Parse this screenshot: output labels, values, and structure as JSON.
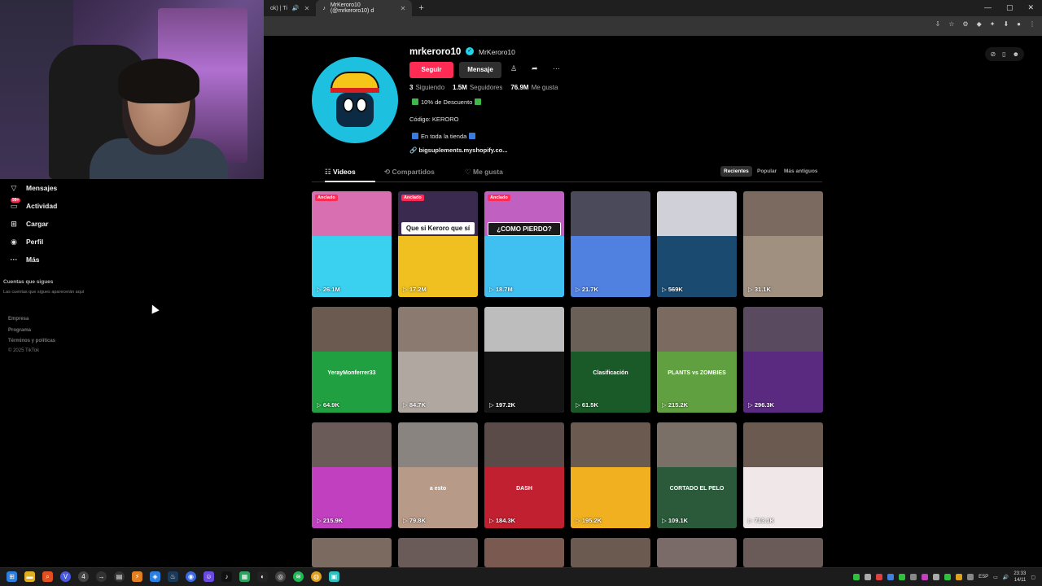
{
  "browser": {
    "tabs": [
      {
        "title": "ok) | Ti",
        "active": false
      },
      {
        "title": "MrKeroro10 (@mrkeroro10) d",
        "active": true
      }
    ],
    "new_tab": "+"
  },
  "nav": {
    "items": [
      {
        "label": "Mensajes",
        "icon": "send-icon"
      },
      {
        "label": "Actividad",
        "icon": "inbox-icon",
        "badge": "99+"
      },
      {
        "label": "Cargar",
        "icon": "upload-icon"
      },
      {
        "label": "Perfil",
        "icon": "avatar-icon"
      },
      {
        "label": "Más",
        "icon": "more-icon"
      }
    ],
    "following_title": "Cuentas que sigues",
    "following_text": "Las cuentas que sigues aparecerán aquí",
    "footer": [
      "Empresa",
      "Programa",
      "Términos y políticas",
      "© 2025 TikTok"
    ]
  },
  "profile": {
    "username": "mrkeroro10",
    "nickname": "MrKeroro10",
    "follow_label": "Seguir",
    "message_label": "Mensaje",
    "stats": [
      {
        "value": "3",
        "label": "Siguiendo"
      },
      {
        "value": "1.5M",
        "label": "Seguidores"
      },
      {
        "value": "76.9M",
        "label": "Me gusta"
      }
    ],
    "bio": [
      "10% de Descuento",
      "Código: KERORO",
      "En toda la tienda"
    ],
    "link": "bigsuplements.myshopify.co..."
  },
  "tabs": {
    "videos": "Videos",
    "reposts": "Compartidos",
    "liked": "Me gusta",
    "sort": [
      "Recientes",
      "Popular",
      "Más antiguos"
    ]
  },
  "videos": [
    {
      "views": "26.1M",
      "pinned": "Anclado",
      "caption": "",
      "bg": "#d86fb0",
      "ov": "#3ad0f0"
    },
    {
      "views": "17.2M",
      "pinned": "Anclado",
      "caption": "Que si Keroro que sí",
      "bg": "#3a2a50",
      "ov": "#f0c020"
    },
    {
      "views": "18.7M",
      "pinned": "Anclado",
      "caption": "¿COMO PIERDO?",
      "bg": "#c060c0",
      "ov": "#40c0f0"
    },
    {
      "views": "21.7K",
      "pinned": "",
      "caption": "",
      "bg": "#4a4a5a",
      "ov": "#5080e0"
    },
    {
      "views": "569K",
      "pinned": "",
      "caption": "",
      "bg": "#d0d0d8",
      "ov": "#1a4a70"
    },
    {
      "views": "31.1K",
      "pinned": "",
      "caption": "",
      "bg": "#7a6a60",
      "ov": "#a09080"
    },
    {
      "views": "64.9K",
      "pinned": "",
      "caption": "",
      "bg": "#6a5a50",
      "ov": "#20a040",
      "ovtext": "YerayMonferrer33"
    },
    {
      "views": "84.7K",
      "pinned": "",
      "caption": "",
      "bg": "#8a7a70",
      "ov": "#b0a8a0"
    },
    {
      "views": "197.2K",
      "pinned": "",
      "caption": "",
      "bg": "#bdbdbd",
      "ov": "#151515"
    },
    {
      "views": "61.5K",
      "pinned": "",
      "caption": "",
      "bg": "#6a6058",
      "ov": "#1a5a28",
      "ovtext": "Clasificación"
    },
    {
      "views": "215.2K",
      "pinned": "",
      "caption": "",
      "bg": "#7a6a60",
      "ov": "#60a040",
      "ovtext": "PLANTS vs ZOMBIES"
    },
    {
      "views": "296.3K",
      "pinned": "",
      "caption": "",
      "bg": "#5a4a60",
      "ov": "#5a2a80"
    },
    {
      "views": "215.9K",
      "pinned": "",
      "caption": "",
      "bg": "#6a5a58",
      "ov": "#c040c0"
    },
    {
      "views": "79.8K",
      "pinned": "",
      "caption": "",
      "bg": "#8a8480",
      "ov": "#b89a88",
      "ovtext": "a esto"
    },
    {
      "views": "184.3K",
      "pinned": "",
      "caption": "",
      "bg": "#5a4a48",
      "ov": "#c02030",
      "ovtext": "DASH"
    },
    {
      "views": "195.2K",
      "pinned": "",
      "caption": "",
      "bg": "#6a5a50",
      "ov": "#f0b020"
    },
    {
      "views": "109.1K",
      "pinned": "",
      "caption": "",
      "bg": "#7a7068",
      "ov": "#2a5a3a",
      "ovtext": "CORTADO EL PELO"
    },
    {
      "views": "713.1K",
      "pinned": "",
      "caption": "",
      "bg": "#6a5a50",
      "ov": "#f0e8e8"
    },
    {
      "views": "",
      "pinned": "",
      "caption": "",
      "bg": "#7a6a60",
      "ov": "#7a6a60"
    },
    {
      "views": "",
      "pinned": "",
      "caption": "",
      "bg": "#6a5a58",
      "ov": "#6a5a58"
    },
    {
      "views": "",
      "pinned": "",
      "caption": "",
      "bg": "#7a5a50",
      "ov": "#7a5a50"
    },
    {
      "views": "",
      "pinned": "",
      "caption": "",
      "bg": "#6a5a50",
      "ov": "#6a5a50"
    },
    {
      "views": "",
      "pinned": "",
      "caption": "",
      "bg": "#7a6a68",
      "ov": "#7a6a68"
    },
    {
      "views": "",
      "pinned": "",
      "caption": "",
      "bg": "#6a5a58",
      "ov": "#6a5a58"
    }
  ],
  "taskbar": {
    "lang": "ESP",
    "time": "23:33",
    "date": "14/11"
  },
  "colors": {
    "accent": "#fe2c55",
    "bg": "#000000",
    "verified": "#20d5ec"
  }
}
